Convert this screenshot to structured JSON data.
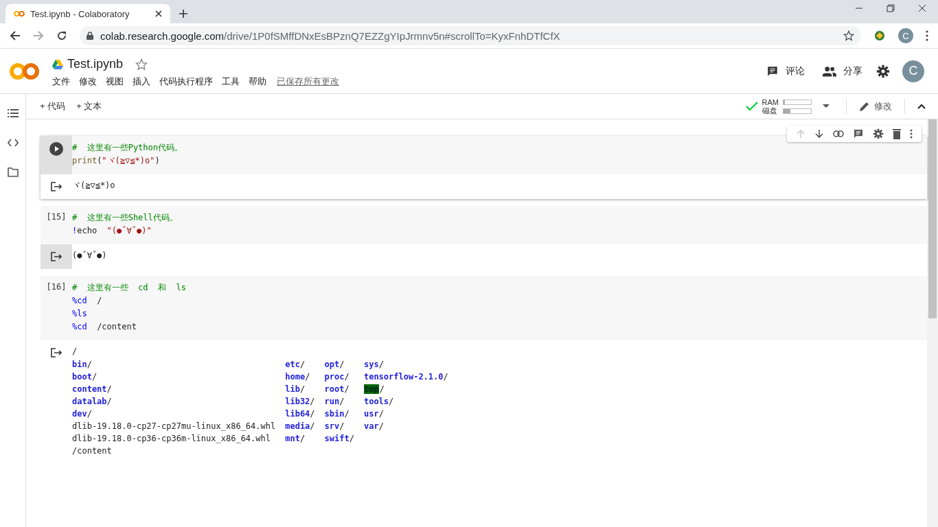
{
  "browser": {
    "tab_title": "Test.ipynb - Colaboratory",
    "url_host": "colab.research.google.com",
    "url_path": "/drive/1P0fSMffDNxEsBPznQ7EZZgYIpJrmnv5n#scrollTo=KyxFnhDTfCfX",
    "avatar": "C"
  },
  "header": {
    "title": "Test.ipynb",
    "menu": [
      "文件",
      "修改",
      "视图",
      "插入",
      "代码执行程序",
      "工具",
      "帮助"
    ],
    "save_status": "已保存所有更改",
    "comment": "评论",
    "share": "分享",
    "avatar": "C"
  },
  "toolbar": {
    "add_code": "+ 代码",
    "add_text": "+ 文本",
    "ram_label": "RAM",
    "disk_label": "磁盘",
    "ram": {
      "level": 0.05
    },
    "disk": {
      "level": 0.25
    },
    "edit": "修改"
  },
  "cells": [
    {
      "selected": true,
      "lines": [
        [
          {
            "text": "#  这里有一些Python代码。",
            "kind": "comment"
          }
        ],
        [
          {
            "text": "print",
            "kind": "func"
          },
          {
            "text": "(",
            "kind": "plain"
          },
          {
            "text": "\"ヾ(≧▽≦*)o\"",
            "kind": "string"
          },
          {
            "text": ")",
            "kind": "plain"
          }
        ]
      ],
      "output": {
        "hovered": false,
        "lines": [
          "ヾ(≧▽≦*)o"
        ]
      }
    },
    {
      "selected": false,
      "count": "[15]",
      "lines": [
        [
          {
            "text": "#  这里有一些Shell代码。",
            "kind": "comment"
          }
        ],
        [
          {
            "text": "!",
            "kind": "magic"
          },
          {
            "text": "echo  ",
            "kind": "plain"
          },
          {
            "text": "\"(●ˇ∀ˇ●)\"",
            "kind": "string"
          }
        ]
      ],
      "output": {
        "hovered": true,
        "lines": [
          "(●ˇ∀ˇ●)"
        ]
      }
    },
    {
      "selected": false,
      "count": "[16]",
      "lines": [
        [
          {
            "text": "#  这里有一些  cd  和  ls",
            "kind": "comment"
          }
        ],
        [
          {
            "text": "%cd",
            "kind": "magic"
          },
          {
            "text": "  /",
            "kind": "plain"
          }
        ],
        [
          {
            "text": "%ls",
            "kind": "magic"
          }
        ],
        [
          {
            "text": "%cd",
            "kind": "magic"
          },
          {
            "text": "  /content",
            "kind": "plain"
          }
        ]
      ],
      "output": {
        "hovered": false,
        "lines": [
          "/"
        ],
        "listing": [
          [
            {
              "name": "bin",
              "suffix": "/",
              "kind": "dir"
            },
            {
              "name": "etc",
              "suffix": "/",
              "kind": "dir"
            },
            {
              "name": "opt",
              "suffix": "/",
              "kind": "dir"
            },
            {
              "name": "sys",
              "suffix": "/",
              "kind": "dir"
            }
          ],
          [
            {
              "name": "boot",
              "suffix": "/",
              "kind": "dir"
            },
            {
              "name": "home",
              "suffix": "/",
              "kind": "dir"
            },
            {
              "name": "proc",
              "suffix": "/",
              "kind": "dir"
            },
            {
              "name": "tensorflow-2.1.0",
              "suffix": "/",
              "kind": "dir"
            }
          ],
          [
            {
              "name": "content",
              "suffix": "/",
              "kind": "dir"
            },
            {
              "name": "lib",
              "suffix": "/",
              "kind": "dir"
            },
            {
              "name": "root",
              "suffix": "/",
              "kind": "dir"
            },
            {
              "name": "tmp",
              "suffix": "/",
              "kind": "dir",
              "highlighted": true
            }
          ],
          [
            {
              "name": "datalab",
              "suffix": "/",
              "kind": "dir"
            },
            {
              "name": "lib32",
              "suffix": "/",
              "kind": "dir"
            },
            {
              "name": "run",
              "suffix": "/",
              "kind": "dir"
            },
            {
              "name": "tools",
              "suffix": "/",
              "kind": "dir"
            }
          ],
          [
            {
              "name": "dev",
              "suffix": "/",
              "kind": "dir"
            },
            {
              "name": "lib64",
              "suffix": "/",
              "kind": "dir"
            },
            {
              "name": "sbin",
              "suffix": "/",
              "kind": "dir"
            },
            {
              "name": "usr",
              "suffix": "/",
              "kind": "dir"
            }
          ],
          [
            {
              "name": "dlib-19.18.0-cp27-cp27mu-linux_x86_64.whl",
              "kind": "file"
            },
            {
              "name": "media",
              "suffix": "/",
              "kind": "dir"
            },
            {
              "name": "srv",
              "suffix": "/",
              "kind": "dir"
            },
            {
              "name": "var",
              "suffix": "/",
              "kind": "dir"
            }
          ],
          [
            {
              "name": "dlib-19.18.0-cp36-cp36m-linux_x86_64.whl",
              "kind": "file"
            },
            {
              "name": "mnt",
              "suffix": "/",
              "kind": "dir"
            },
            {
              "name": "swift",
              "suffix": "/",
              "kind": "dir"
            }
          ]
        ],
        "tail": [
          "/content"
        ]
      }
    }
  ]
}
